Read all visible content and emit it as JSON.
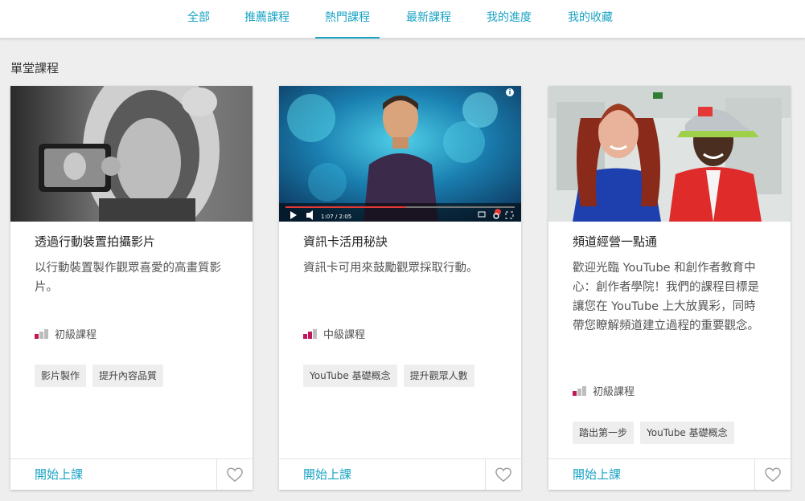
{
  "nav": {
    "tabs": [
      {
        "label": "全部"
      },
      {
        "label": "推薦課程"
      },
      {
        "label": "熱門課程",
        "active": true
      },
      {
        "label": "最新課程"
      },
      {
        "label": "我的進度"
      },
      {
        "label": "我的收藏"
      }
    ]
  },
  "section": {
    "title": "單堂課程"
  },
  "colors": {
    "accent": "#1aa3c4",
    "level_active": "#c2185b",
    "level_inactive": "#bdbdbd"
  },
  "cards": [
    {
      "title": "透過行動裝置拍攝影片",
      "description": "以行動裝置製作觀眾喜愛的高畫質影片。",
      "level": "初級課程",
      "level_value": 1,
      "tags": [
        "影片製作",
        "提升內容品質"
      ],
      "start_label": "開始上課",
      "favorite_icon": "heart-outline-icon"
    },
    {
      "title": "資訊卡活用秘訣",
      "description": "資訊卡可用來鼓勵觀眾採取行動。",
      "level": "中級課程",
      "level_value": 2,
      "tags": [
        "YouTube 基礎概念",
        "提升觀眾人數"
      ],
      "start_label": "開始上課",
      "favorite_icon": "heart-outline-icon",
      "video_time": "1:07 / 2:05"
    },
    {
      "title": "頻道經營一點通",
      "description": "歡迎光臨 YouTube 和創作者教育中心：創作者學院！我們的課程目標是讓您在 YouTube 上大放異彩，同時帶您瞭解頻道建立過程的重要觀念。",
      "level": "初級課程",
      "level_value": 1,
      "tags": [
        "踏出第一步",
        "YouTube 基礎概念"
      ],
      "start_label": "開始上課",
      "favorite_icon": "heart-outline-icon"
    }
  ]
}
